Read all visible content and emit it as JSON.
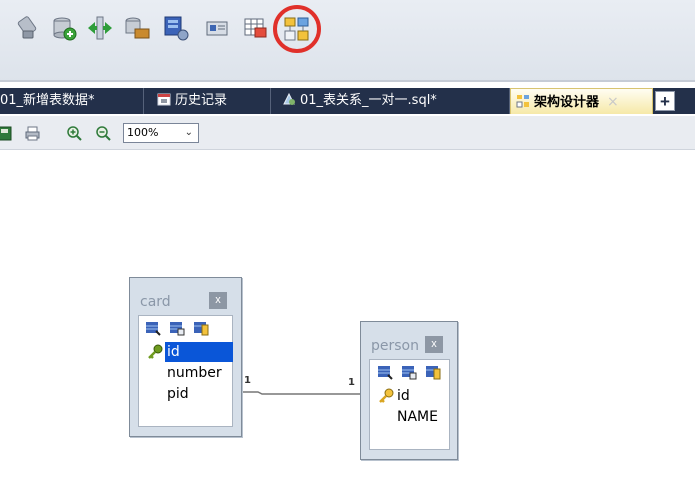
{
  "toolbar": {
    "icons": [
      "tool-icon",
      "database-add-icon",
      "transfer-icon",
      "database-export-icon",
      "monitor-database-icon",
      "card-icon",
      "grid-table-icon",
      "schema-designer-icon"
    ],
    "highlight_color": "#e0302a"
  },
  "tabs": [
    {
      "label": "01_新增表数据*",
      "icon": "table-icon"
    },
    {
      "label": "历史记录",
      "icon": "calendar-icon"
    },
    {
      "label": "01_表关系_一对一.sql*",
      "icon": "sql-icon"
    },
    {
      "label": "架构设计器",
      "icon": "schema-designer-icon",
      "active": true,
      "close": "×"
    }
  ],
  "tab_add_label": "+",
  "subbar": {
    "zoom_value": "100%",
    "icons": [
      "save-icon",
      "print-icon",
      "zoom-in-icon",
      "zoom-out-icon"
    ]
  },
  "diagram": {
    "tables": [
      {
        "name": "card",
        "close": "x",
        "fields": [
          "id",
          "number",
          "pid"
        ],
        "primary_key": "id",
        "selected_field": "id"
      },
      {
        "name": "person",
        "close": "x",
        "fields": [
          "id",
          "NAME"
        ],
        "primary_key": "id"
      }
    ],
    "relationship": {
      "from": "card",
      "to": "person",
      "from_cardinality": "1",
      "to_cardinality": "1"
    }
  }
}
